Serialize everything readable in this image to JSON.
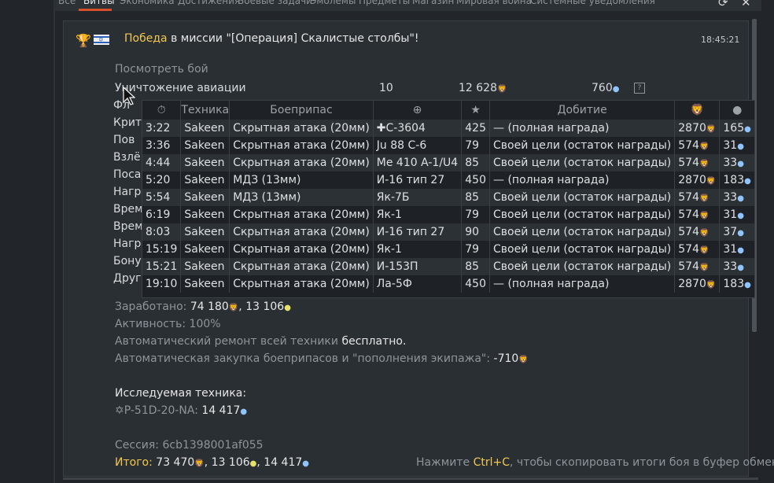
{
  "tabs": [
    {
      "label": "Все"
    },
    {
      "label": "Битвы"
    },
    {
      "label": "Экономика"
    },
    {
      "label": "Достижения"
    },
    {
      "label": "Боевые задачи"
    },
    {
      "label": "Эмблемы"
    },
    {
      "label": "Предметы"
    },
    {
      "label": "Магазин"
    },
    {
      "label": "Мировая война"
    },
    {
      "label": "Системные уведомления"
    }
  ],
  "message": {
    "result": "Победа",
    "title_rest": "в миссии \"[Операция] Скалистые столбы\"!",
    "time": "18:45:21",
    "view_battle": "Посмотреть бой",
    "summary_row": {
      "label": "Уничтожение авиации",
      "count": "10",
      "silver": "12 628",
      "rp": "760"
    },
    "hidden_row_prefixes": [
      "Фл",
      "Крит",
      "Пов",
      "Взлё",
      "Поса",
      "Нагр",
      "Врем",
      "Врем",
      "Нагр",
      "Бону",
      "Друг"
    ],
    "earned_label": "Заработано:",
    "earned_silver": "74 180",
    "earned_gold": "13 106",
    "activity_label": "Активность:",
    "activity_value": "100%",
    "repair_text": "Автоматический ремонт всей техники",
    "repair_value": "бесплатно.",
    "ammo_text": "Автоматическая закупка боеприпасов и \"пополнения экипажа\":",
    "ammo_value": "-710",
    "research_label": "Исследуемая техника:",
    "research_vehicle": "✡P-51D-20-NA:",
    "research_value": "14 417",
    "session_label": "Сессия:",
    "session_value": "6cb1398001af055",
    "total_label": "Итого:",
    "total_silver": "73 470",
    "total_gold": "13 106",
    "total_rp": "14 417",
    "copy_hint_pre": "Нажмите",
    "copy_hint_key": "Ctrl+C",
    "copy_hint_post": ", чтобы скопировать итоги боя в буфер обмена"
  },
  "popup": {
    "headers": [
      "Техника",
      "Боеприпас",
      "Добитие"
    ],
    "rows": [
      {
        "time": "3:22",
        "vehicle": "Sakeen",
        "ammo": "Скрытная атака (20мм)",
        "target": "✚С-3604",
        "score": "425",
        "finish": "— (полная награда)",
        "silver": "2870",
        "rp": "165"
      },
      {
        "time": "3:36",
        "vehicle": "Sakeen",
        "ammo": "Скрытная атака (20мм)",
        "target": "Ju 88 C-6",
        "score": "79",
        "finish": "Своей цели (остаток награды)",
        "silver": "574",
        "rp": "31"
      },
      {
        "time": "4:44",
        "vehicle": "Sakeen",
        "ammo": "Скрытная атака (20мм)",
        "target": "Me 410 A-1/U4",
        "score": "85",
        "finish": "Своей цели (остаток награды)",
        "silver": "574",
        "rp": "33"
      },
      {
        "time": "5:20",
        "vehicle": "Sakeen",
        "ammo": "МДЗ (13мм)",
        "target": "И-16 тип 27",
        "score": "450",
        "finish": "— (полная награда)",
        "silver": "2870",
        "rp": "183"
      },
      {
        "time": "5:54",
        "vehicle": "Sakeen",
        "ammo": "МДЗ (13мм)",
        "target": "Як-7Б",
        "score": "85",
        "finish": "Своей цели (остаток награды)",
        "silver": "574",
        "rp": "33"
      },
      {
        "time": "6:19",
        "vehicle": "Sakeen",
        "ammo": "Скрытная атака (20мм)",
        "target": "Як-1",
        "score": "79",
        "finish": "Своей цели (остаток награды)",
        "silver": "574",
        "rp": "31"
      },
      {
        "time": "8:03",
        "vehicle": "Sakeen",
        "ammo": "Скрытная атака (20мм)",
        "target": "И-16 тип 27",
        "score": "90",
        "finish": "Своей цели (остаток награды)",
        "silver": "574",
        "rp": "37"
      },
      {
        "time": "15:19",
        "vehicle": "Sakeen",
        "ammo": "Скрытная атака (20мм)",
        "target": "Як-1",
        "score": "79",
        "finish": "Своей цели (остаток награды)",
        "silver": "574",
        "rp": "31"
      },
      {
        "time": "15:21",
        "vehicle": "Sakeen",
        "ammo": "Скрытная атака (20мм)",
        "target": "И-153П",
        "score": "85",
        "finish": "Своей цели (остаток награды)",
        "silver": "574",
        "rp": "33"
      },
      {
        "time": "19:10",
        "vehicle": "Sakeen",
        "ammo": "Скрытная атака (20мм)",
        "target": "Ла-5Ф",
        "score": "450",
        "finish": "— (полная награда)",
        "silver": "2870",
        "rp": "183"
      }
    ]
  },
  "icons": {
    "silver": "silver-lion-icon",
    "rp": "research-point-icon",
    "gold": "golden-eagle-icon",
    "timer": "stopwatch-icon",
    "crosshair": "crosshair-icon",
    "star": "star-icon"
  },
  "colors": {
    "accent_tab": "#d8502a",
    "win": "#f3c850",
    "ctrl_key": "#f3c850",
    "rp": "#8fc4ff"
  }
}
